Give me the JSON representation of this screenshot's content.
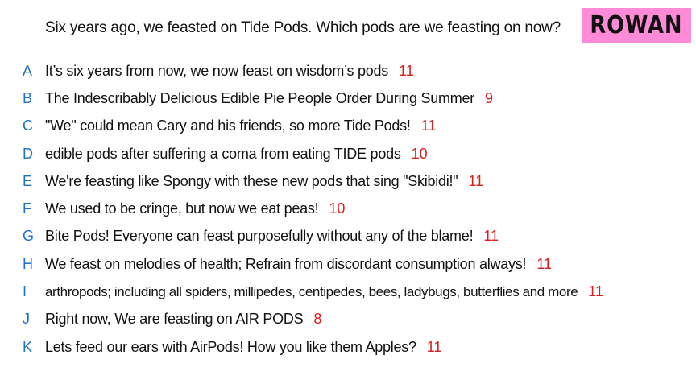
{
  "question": "Six years ago, we feasted on Tide Pods. Which pods are we feasting on now?",
  "player": {
    "name": "ROWAN",
    "badge_color": "#ff8ad8"
  },
  "colors": {
    "letter": "#1f72c9",
    "score": "#d81e1e",
    "text": "#111111"
  },
  "answers": [
    {
      "letter": "A",
      "text": "It’s six years from now, we now feast on wisdom’s pods",
      "score": "11"
    },
    {
      "letter": "B",
      "text": "The Indescribably Delicious Edible Pie People Order During Summer",
      "score": "9"
    },
    {
      "letter": "C",
      "text": "\"We\" could mean Cary and his friends, so more Tide Pods!",
      "score": "11"
    },
    {
      "letter": "D",
      "text": "edible pods after suffering a coma from eating TIDE pods",
      "score": "10"
    },
    {
      "letter": "E",
      "text": "We're feasting like Spongy with these new pods that sing \"Skibidi!\"",
      "score": "11"
    },
    {
      "letter": "F",
      "text": "We used to be cringe, but now we eat peas!",
      "score": "10"
    },
    {
      "letter": "G",
      "text": "Bite Pods! Everyone can feast purposefully without any of the blame!",
      "score": "11"
    },
    {
      "letter": "H",
      "text": "We feast on melodies of health; Refrain from discordant consumption always!",
      "score": "11"
    },
    {
      "letter": "I",
      "text": "arthropods; including all spiders, millipedes, centipedes, bees, ladybugs, butterflies and more",
      "score": "11"
    },
    {
      "letter": "J",
      "text": "Right now, We are feasting on AIR PODS",
      "score": "8"
    },
    {
      "letter": "K",
      "text": "Lets feed our ears with AirPods! How you like them Apples?",
      "score": "11"
    }
  ]
}
